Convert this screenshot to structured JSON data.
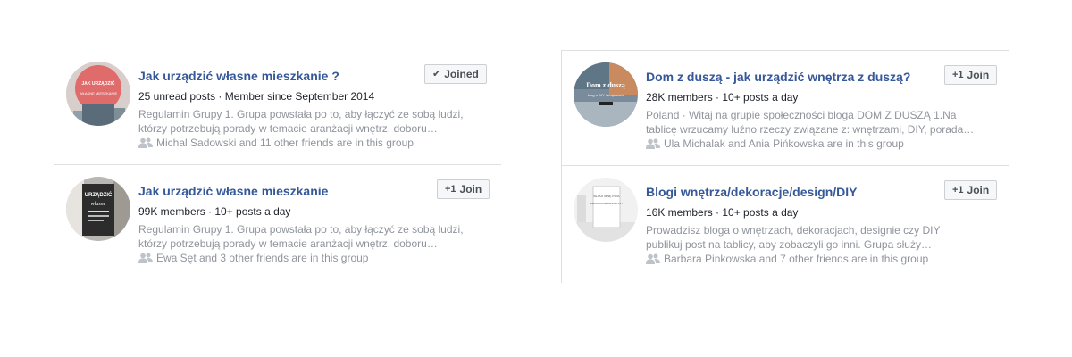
{
  "groups": [
    {
      "title": "Jak urządzić własne mieszkanie ?",
      "meta": "25 unread posts · Member since September 2014",
      "desc_line1": "Regulamin Grupy 1. Grupa powstała po to, aby łączyć ze sobą ludzi,",
      "desc_line2": "którzy potrzebują porady w temacie aranżacji wnętrz, doboru…",
      "friends": "Michal Sadowski and 11 other friends are in this group",
      "button_label": "Joined",
      "button_icon": "check-icon",
      "avatar_text_1": "JAK URZĄDZIĆ",
      "avatar_text_2": "WŁASNE MIESZKANIE"
    },
    {
      "title": "Jak urządzić własne mieszkanie",
      "meta": "99K members · 10+ posts a day",
      "desc_line1": "Regulamin Grupy 1. Grupa powstała po to, aby łączyć ze sobą ludzi,",
      "desc_line2": "którzy potrzebują porady w temacie aranżacji wnętrz, doboru…",
      "friends": "Ewa Sęt and 3 other friends are in this group",
      "button_label": "Join",
      "button_icon": "plus-one-icon",
      "avatar_text_1": "URZĄDZIĆ",
      "avatar_text_2": "własne"
    },
    {
      "title": "Dom z duszą - jak urządzić wnętrza z duszą?",
      "meta": "28K members · 10+ posts a day",
      "desc_line1": "Poland · Witaj na grupie społeczności bloga DOM Z DUSZĄ 1.Na",
      "desc_line2": "tablicę wrzucamy luźno rzeczy związane z: wnętrzami, DIY, porada…",
      "friends": "Ula Michalak and Ania Pińkowska are in this group",
      "button_label": "Join",
      "button_icon": "plus-one-icon",
      "avatar_text_1": "Dom z duszą",
      "avatar_text_2": "blog o DIY i wnętrzach"
    },
    {
      "title": "Blogi wnętrza/dekoracje/design/DIY",
      "meta": "16K members · 10+ posts a day",
      "desc_line1": "Prowadzisz bloga o wnętrzach, dekoracjach, designie czy DIY",
      "desc_line2": "publikuj post na tablicy, aby zobaczyli go inni. Grupa służy…",
      "friends": "Barbara Pinkowska and 7 other friends are in this group",
      "button_label": "Join",
      "button_icon": "plus-one-icon",
      "avatar_text_1": "BLOGI WNĘTRZA",
      "avatar_text_2": "DEKORACJE DESIGN DIY"
    }
  ],
  "colors": {
    "link": "#365899",
    "secondary_text": "#90949c",
    "border": "#dddfe2",
    "button_bg": "#f6f7f9"
  }
}
